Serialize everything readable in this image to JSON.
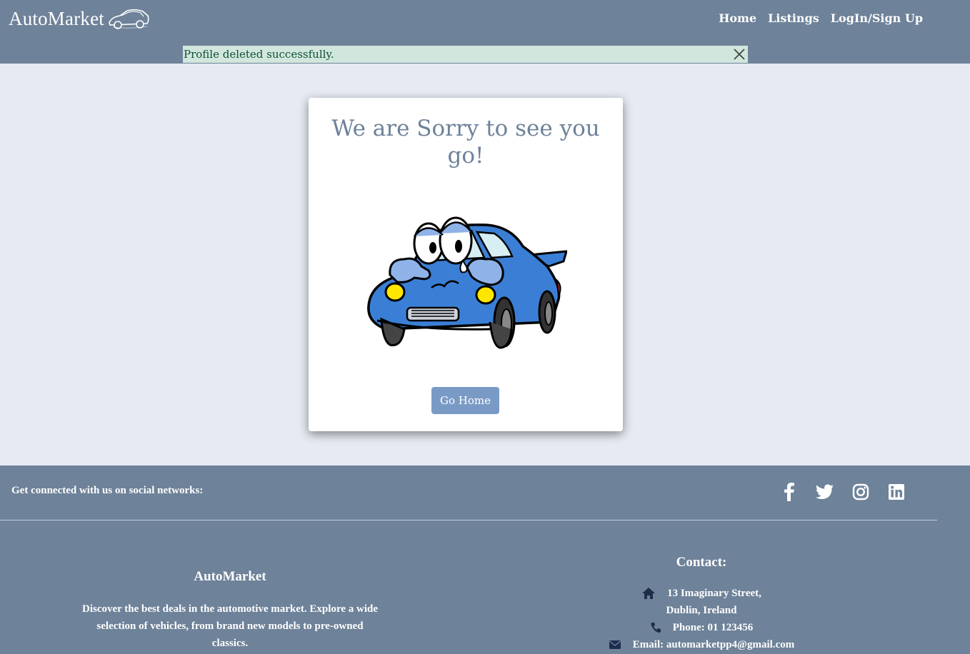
{
  "header": {
    "brand": "AutoMarket",
    "nav": [
      {
        "label": "Home"
      },
      {
        "label": "Listings"
      },
      {
        "label": "LogIn/Sign Up"
      }
    ]
  },
  "alert": {
    "message": "Profile deleted successfully."
  },
  "card": {
    "title": "We are Sorry to see you go!",
    "button": "Go Home"
  },
  "footer": {
    "social_text": "Get connected with us on social networks:",
    "social_icons": [
      "facebook-icon",
      "twitter-icon",
      "instagram-icon",
      "linkedin-icon"
    ],
    "about": {
      "title": "AutoMarket",
      "text": "Discover the best deals in the automotive market. Explore a wide selection of vehicles, from brand new models to pre-owned classics."
    },
    "contact": {
      "title": "Contact:",
      "address_line1": "13 Imaginary Street,",
      "address_line2": "Dublin, Ireland",
      "phone": "Phone: 01 123456",
      "email": "Email: automarketpp4@gmail.com"
    }
  },
  "colors": {
    "primary": "#6e8299",
    "background": "#e6eaf2",
    "alert_bg": "#d1e7dd",
    "alert_text": "#0f5132",
    "button": "#7a9ac6",
    "icon_dark": "#1f2d4d"
  }
}
